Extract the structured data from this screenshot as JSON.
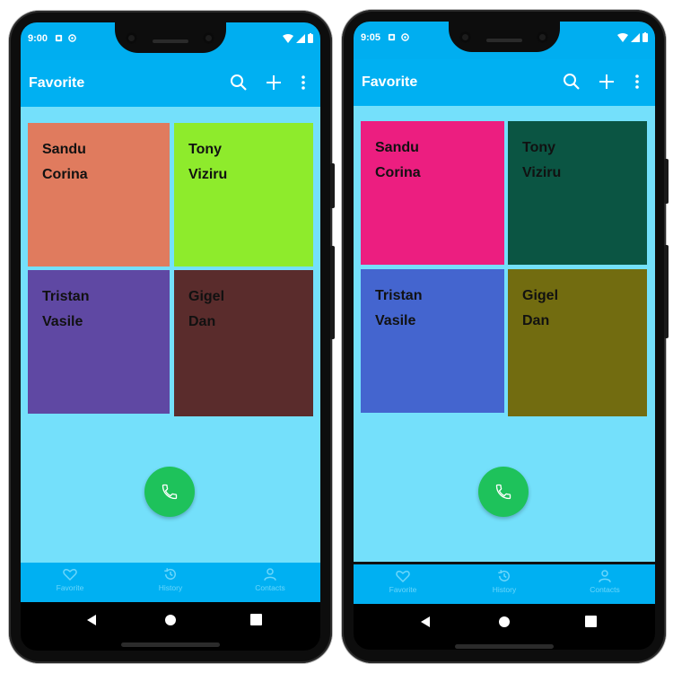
{
  "app": {
    "title": "Favorite",
    "actions": [
      "search-icon",
      "add-icon",
      "more-vert-icon"
    ],
    "contacts": [
      {
        "first": "Sandu",
        "last": "Corina"
      },
      {
        "first": "Tony",
        "last": "Viziru"
      },
      {
        "first": "Tristan",
        "last": "Vasile"
      },
      {
        "first": "Gigel",
        "last": "Dan"
      }
    ],
    "bottom_nav": [
      {
        "label": "Favorite",
        "icon": "heart-icon"
      },
      {
        "label": "History",
        "icon": "history-icon"
      },
      {
        "label": "Contacts",
        "icon": "person-icon"
      }
    ],
    "fab_icon": "phone-icon"
  },
  "left_phone": {
    "time": "9:00",
    "tile_colors": [
      "#e07b5e",
      "#8eeb2c",
      "#5f48a3",
      "#5a2c2c"
    ]
  },
  "right_phone": {
    "time": "9:05",
    "tile_colors": [
      "#ec1e80",
      "#0b5543",
      "#4465cf",
      "#726c10"
    ]
  },
  "colors": {
    "status_bar": "#00aef0",
    "app_bar": "#00b0f2",
    "content_bg": "#74e0fb",
    "fab": "#1ec25b",
    "nav_label": "#6ad6fb"
  }
}
